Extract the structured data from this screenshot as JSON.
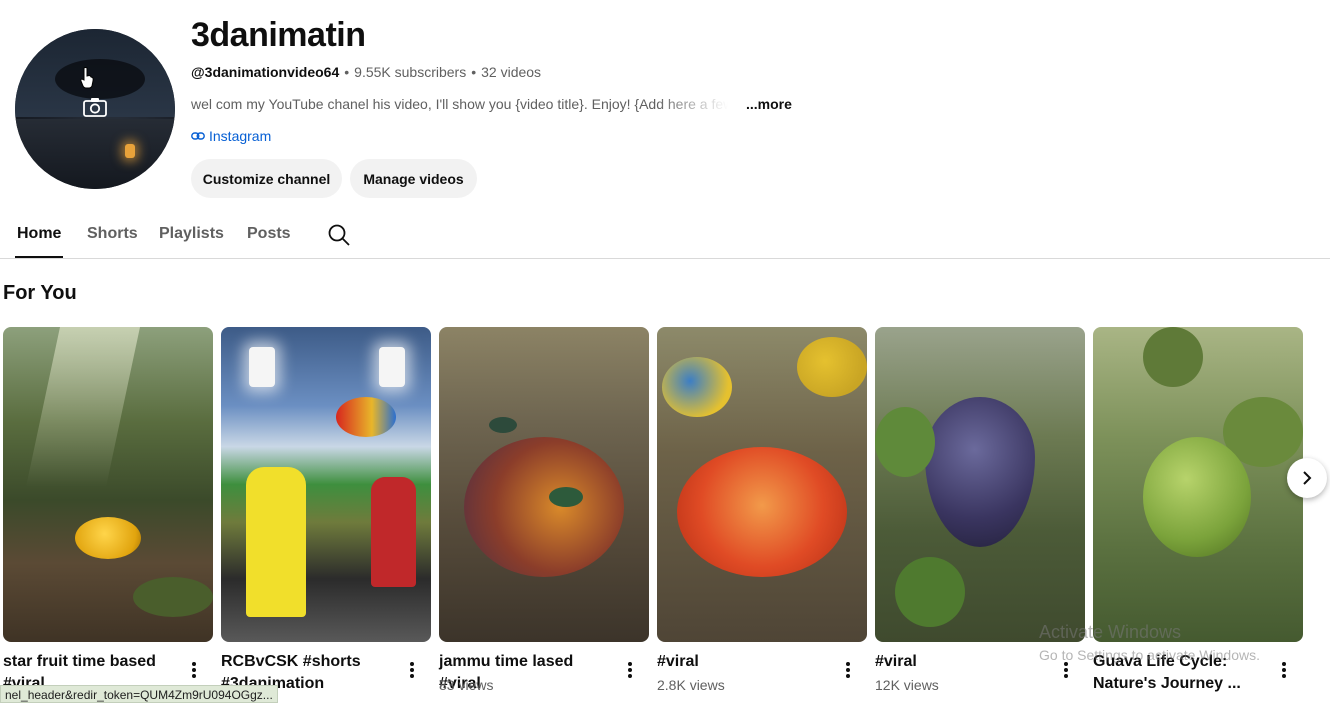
{
  "channel": {
    "title": "3danimatin",
    "handle": "@3danimationvideo64",
    "subscribers": "9.55K subscribers",
    "videos": "32 videos",
    "description": "wel com my YouTube chanel his video, I'll show you {video title}. Enjoy! {Add here a few",
    "more_label": "...more",
    "link_label": "Instagram"
  },
  "buttons": {
    "customize": "Customize channel",
    "manage": "Manage videos"
  },
  "tabs": [
    "Home",
    "Shorts",
    "Playlists",
    "Posts"
  ],
  "section_title": "For You",
  "shorts": [
    {
      "title": "star fruit time based #viral",
      "views": ""
    },
    {
      "title": "RCBvCSK #shorts #3danimation",
      "views": ""
    },
    {
      "title": "jammu time lased #viral",
      "views": "83 views"
    },
    {
      "title": "#viral",
      "views": "2.8K views"
    },
    {
      "title": "#viral",
      "views": "12K views"
    },
    {
      "title": "Guava Life Cycle: Nature's Journey ...",
      "views": ""
    }
  ],
  "watermark": {
    "line1": "Activate Windows",
    "line2": "Go to Settings to activate Windows."
  },
  "status_url": "nel_header&redir_token=QUM4Zm9rU094OGgz...",
  "colors": {
    "link": "#065fd4",
    "button_bg": "#f2f2f2",
    "secondary_text": "#606060"
  }
}
